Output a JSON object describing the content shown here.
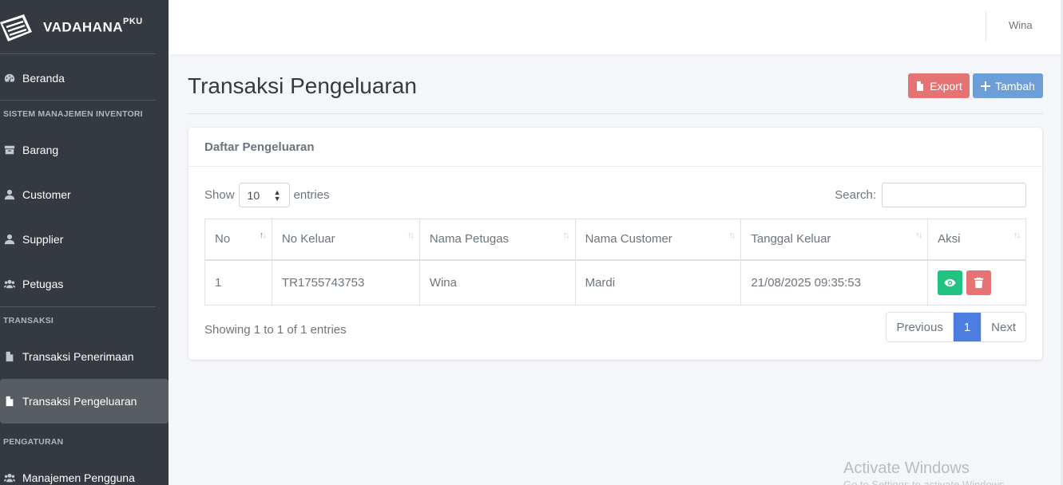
{
  "brand": {
    "name": "VADAHANA",
    "sup": "PKU"
  },
  "sidebar": {
    "beranda": "Beranda",
    "section_inventori": "SISTEM MANAJEMEN INVENTORI",
    "barang": "Barang",
    "customer": "Customer",
    "supplier": "Supplier",
    "petugas": "Petugas",
    "section_transaksi": "TRANSAKSI",
    "penerimaan": "Transaksi Penerimaan",
    "pengeluaran": "Transaksi Pengeluaran",
    "section_pengaturan": "PENGATURAN",
    "manajemen": "Manajemen Pengguna"
  },
  "topbar": {
    "user": "Wina"
  },
  "page": {
    "title": "Transaksi Pengeluaran",
    "export_label": "Export",
    "tambah_label": "Tambah",
    "card_title": "Daftar Pengeluaran",
    "show_label": "Show",
    "entries_value": "10",
    "entries_label": "entries",
    "search_label": "Search:",
    "info": "Showing 1 to 1 of 1 entries"
  },
  "table": {
    "headers": [
      "No",
      "No Keluar",
      "Nama Petugas",
      "Nama Customer",
      "Tanggal Keluar",
      "Aksi"
    ],
    "rows": [
      [
        "1",
        "TR1755743753",
        "Wina",
        "Mardi",
        "21/08/2025 09:35:53"
      ]
    ]
  },
  "pagination": {
    "previous": "Previous",
    "current": "1",
    "next": "Next"
  },
  "watermark": {
    "line1": "Activate Windows",
    "line2": "Go to Settings to activate Windows."
  },
  "colors": {
    "sidebar": "#343a40",
    "export": "#e57373",
    "tambah": "#6c9fd8",
    "view": "#20c382",
    "page_active": "#4c7de0"
  }
}
